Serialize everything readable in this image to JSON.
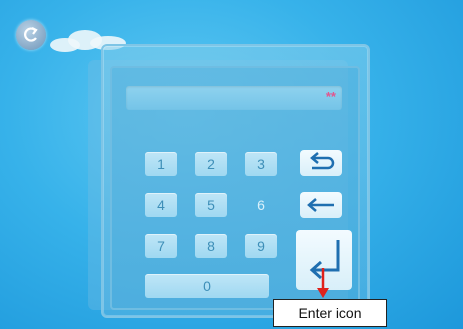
{
  "display": {
    "value": "**"
  },
  "keypad": {
    "keys": [
      "1",
      "2",
      "3",
      "4",
      "5",
      "6",
      "7",
      "8",
      "9",
      "0"
    ]
  },
  "icons": {
    "back": "back-arrow-icon",
    "undo": "undo-icon",
    "backspace": "backspace-arrow-icon",
    "enter": "enter-icon"
  },
  "annotation": {
    "label": "Enter icon",
    "arrow_color": "#e0221b"
  },
  "colors": {
    "background": "#37b2ea",
    "key": "#a9dcf3",
    "digit_text": "#3e8fb8"
  }
}
